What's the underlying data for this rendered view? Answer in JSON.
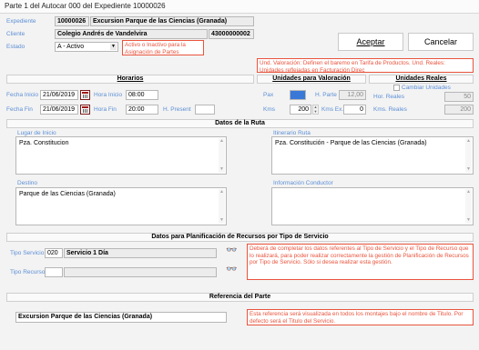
{
  "window": {
    "title": "Parte 1 del Autocar 000 del Expediente 10000026"
  },
  "header": {
    "expediente_label": "Expediente",
    "expediente_num": "10000026",
    "expediente_name": "Excursion Parque de las Ciencias (Granada)",
    "cliente_label": "Cliente",
    "cliente_name": "Colegio Andrés de Vandelvira",
    "cliente_code": "43000000002",
    "estado_label": "Estado",
    "estado_value": "A - Activo",
    "estado_note": "Activo o Inactivo para la Asignación de Partes",
    "aceptar": "Aceptar",
    "cancelar": "Cancelar",
    "unid_note": "Und. Valoración: Definen el baremo en Tarifa de Productos. Und. Reales: Unidades reflejadas en Facturación Direc"
  },
  "sections": {
    "horarios": "Horarios",
    "unidades_valoracion": "Unidades para Valoración",
    "unidades_reales": "Unidades Reales",
    "datos_ruta": "Datos de la Ruta",
    "planificacion": "Datos para Planificación de Recursos por Tipo de Servicio",
    "referencia": "Referencia del Parte"
  },
  "horarios": {
    "fecha_inicio_label": "Fecha Inicio",
    "fecha_inicio": "21/06/2019",
    "hora_inicio_label": "Hora Inicio",
    "hora_inicio": "08:00",
    "fecha_fin_label": "Fecha Fin",
    "fecha_fin": "21/06/2019",
    "hora_fin_label": "Hora Fin",
    "hora_fin": "20:00",
    "h_present_label": "H. Present",
    "h_present": ""
  },
  "valoracion": {
    "pax_label": "Pax",
    "pax": "",
    "h_parte_label": "H. Parte",
    "h_parte": "12,00",
    "kms_label": "Kms",
    "kms": "200",
    "kms_ex_label": "Kms Ex.",
    "kms_ex": "0"
  },
  "reales": {
    "cambiar_label": "Cambiar Unidades",
    "hor_reales_label": "Hor. Reales",
    "hor_reales": "50",
    "kms_reales_label": "Kms. Reales",
    "kms_reales": "200"
  },
  "ruta": {
    "lugar_inicio_label": "Lugar de Inicio",
    "lugar_inicio": "Pza. Constitucion",
    "itinerario_label": "Itinerario Ruta",
    "itinerario": "Pza. Constitución - Parque de las Ciencias (Granada)",
    "destino_label": "Destino",
    "destino": "Parque de las Ciencias (Granada)",
    "info_conductor_label": "Información Conductor",
    "info_conductor": ""
  },
  "planificacion": {
    "tipo_servicio_label": "Tipo Servicio",
    "tipo_servicio_code": "020",
    "tipo_servicio_name": "Servicio 1 Día",
    "tipo_recurso_label": "Tipo Recurso",
    "tipo_recurso_code": "",
    "tipo_recurso_name": "",
    "note": "Deberá de completar los datos referentes al Tipo de Servicio y el Tipo de Recurso que lo realizará, para poder realizar correctamente la gestión de Planificación de Recursos por Tipo de Servicio. Sólo si desea realizar esta gestión."
  },
  "referencia": {
    "value": "Excursion Parque de las Ciencias (Granada)",
    "note": "Esta referencia será visualizada en todos los montajes bajo el nombre de Titulo. Por defecto será el Titulo del Servicio."
  },
  "colors": {
    "label_blue": "#5d8fd6",
    "note_red": "#e9543d",
    "pax_highlight": "#3a78d8"
  }
}
